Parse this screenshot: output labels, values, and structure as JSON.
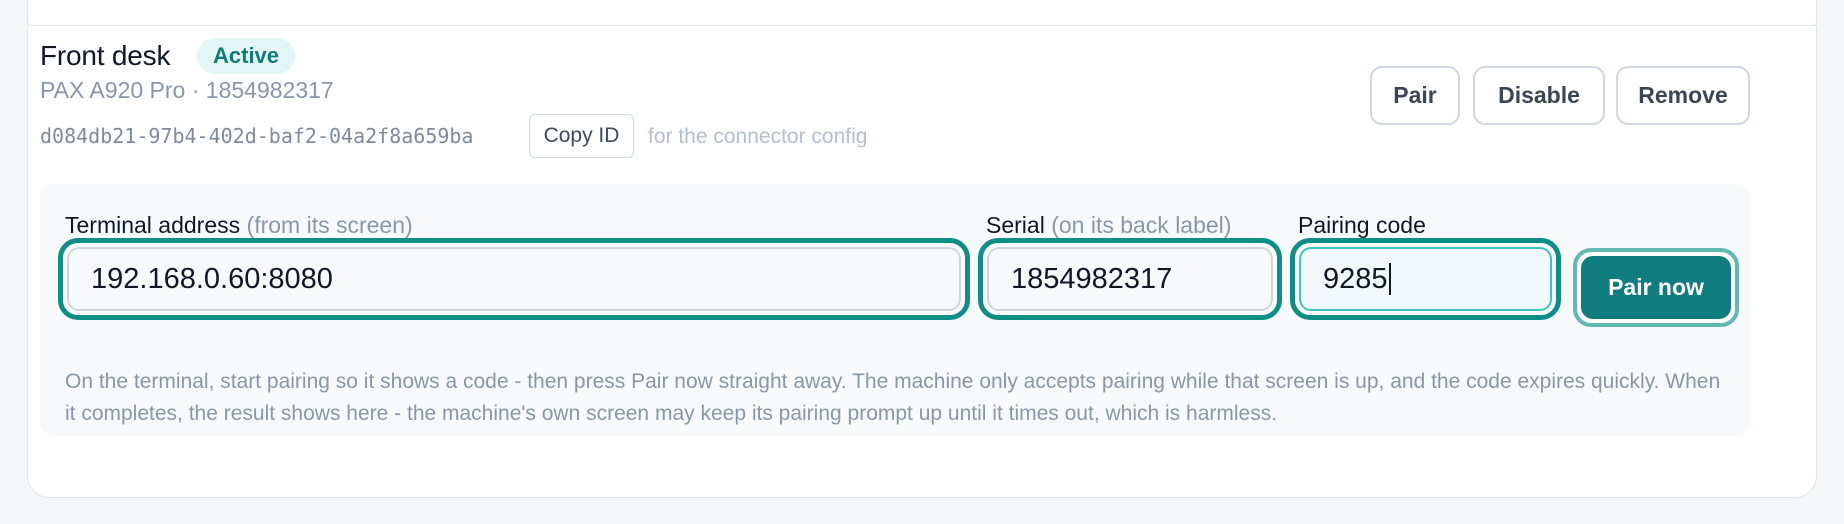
{
  "terminal": {
    "name": "Front desk",
    "status": "Active",
    "model_serial": "PAX A920 Pro · 1854982317",
    "id": "d084db21-97b4-402d-baf2-04a2f8a659ba",
    "copy_label": "Copy ID",
    "copy_hint": "for the connector config"
  },
  "actions": {
    "pair": "Pair",
    "disable": "Disable",
    "remove": "Remove"
  },
  "pairing": {
    "address_label": "Terminal address",
    "address_hint": "(from its screen)",
    "address_value": "192.168.0.60:8080",
    "serial_label": "Serial",
    "serial_hint": "(on its back label)",
    "serial_value": "1854982317",
    "code_label": "Pairing code",
    "code_value": "9285",
    "submit_label": "Pair now",
    "help_text": "On the terminal, start pairing so it shows a code - then press Pair now straight away. The machine only accepts pairing while that screen is up, and the code expires quickly. When it completes, the result shows here - the machine's own screen may keep its pairing prompt up until it times out, which is harmless."
  },
  "colors": {
    "accent": "#0f7c80",
    "focus_ring": "#0e8f85",
    "badge_bg": "#e3f6f5",
    "badge_text": "#0e7c78"
  }
}
